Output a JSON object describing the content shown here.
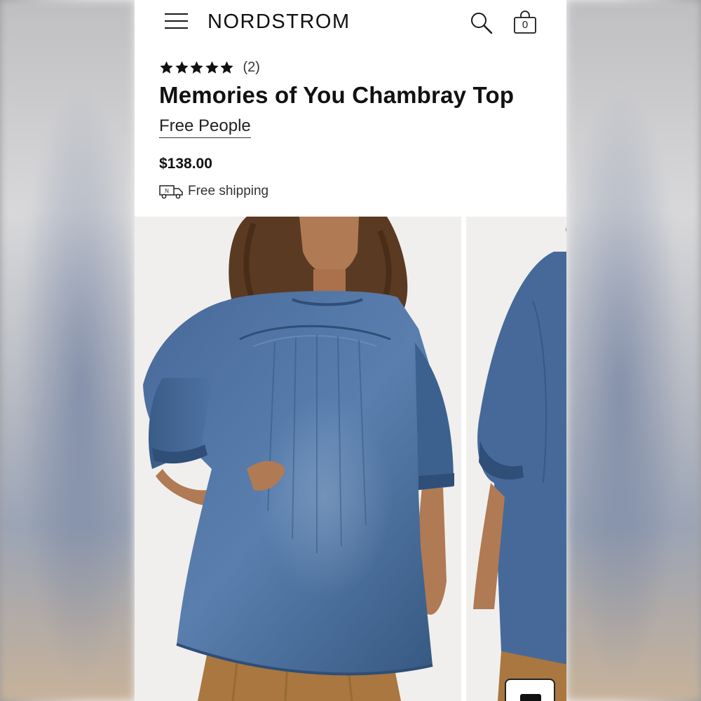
{
  "header": {
    "brand": "NORDSTROM",
    "menu_icon": "hamburger-menu-icon",
    "search_icon": "search-icon",
    "bag_icon": "shopping-bag-icon",
    "bag_count": "0"
  },
  "product": {
    "rating_stars": 5,
    "review_count": "(2)",
    "title": "Memories of You Chambray Top",
    "brand": "Free People",
    "price": "$138.00",
    "shipping_label": "Free shipping",
    "shipping_icon": "nordstrom-truck-icon"
  },
  "gallery": {
    "images": [
      {
        "name": "product-photo-front"
      },
      {
        "name": "product-photo-side"
      }
    ]
  },
  "chat_button": {
    "icon": "chat-icon"
  },
  "colors": {
    "text": "#111111",
    "denim": "#3f6494",
    "denim_dark": "#2f4e78",
    "skirt": "#a9773f",
    "photo_bg": "#f0efed"
  }
}
